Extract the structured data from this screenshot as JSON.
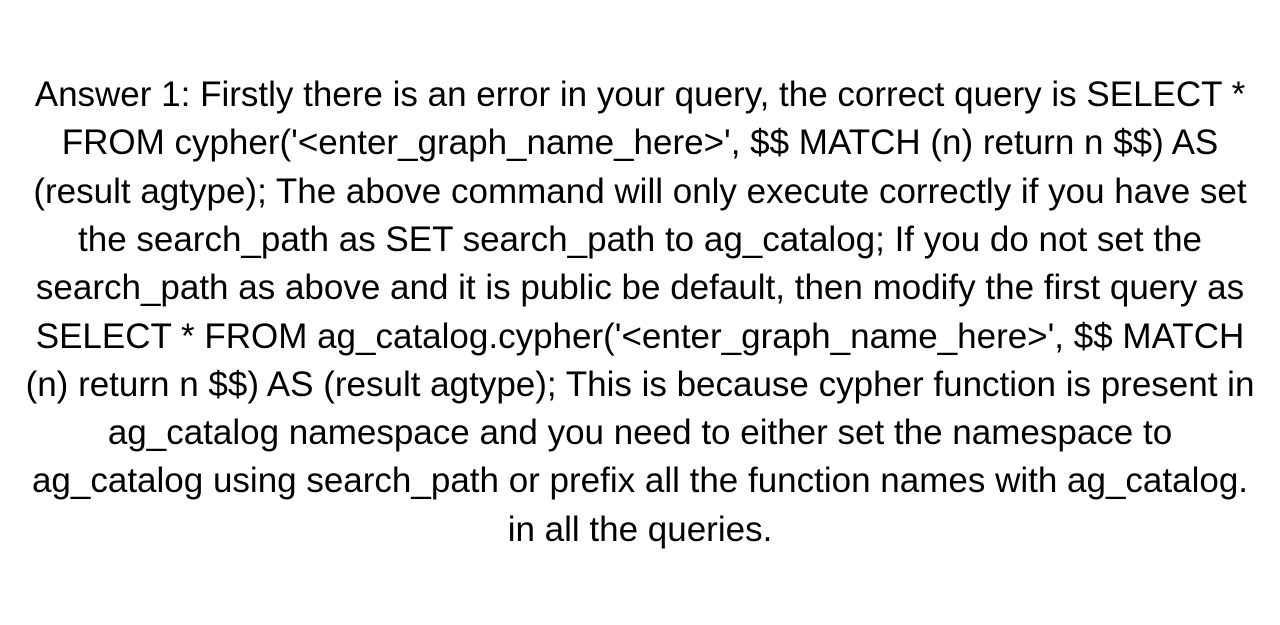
{
  "document": {
    "text": "Answer 1: Firstly there is an error in your query, the correct query is SELECT * FROM cypher('<enter_graph_name_here>', $$ MATCH (n) return n $$) AS (result agtype);  The above command will only execute correctly if you have set the search_path as SET search_path to ag_catalog;  If you do not set the search_path as above and it is public be default, then modify the first query as SELECT * FROM ag_catalog.cypher('<enter_graph_name_here>', $$ MATCH (n) return n $$) AS (result agtype);  This is because cypher function is present in ag_catalog namespace and you need to either set the namespace to ag_catalog using search_path or prefix all the function names with ag_catalog. in all the queries."
  }
}
